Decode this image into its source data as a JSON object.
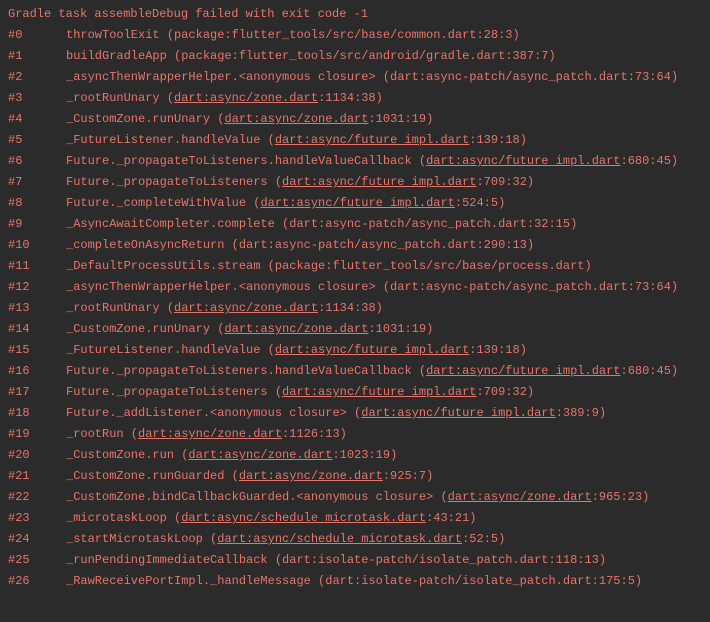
{
  "header": "Gradle task assembleDebug failed with exit code -1",
  "frames": [
    {
      "num": "#0",
      "prefix": "throwToolExit (package:flutter_tools/src/base/common.dart:28:3)",
      "link": null,
      "suffix": null
    },
    {
      "num": "#1",
      "prefix": "buildGradleApp (package:flutter_tools/src/android/gradle.dart:387:7)",
      "link": null,
      "suffix": null
    },
    {
      "num": "#2",
      "prefix": "_asyncThenWrapperHelper.<anonymous closure> (dart:async-patch/async_patch.dart:73:64)",
      "link": null,
      "suffix": null
    },
    {
      "num": "#3",
      "prefix": "_rootRunUnary (",
      "link": "dart:async/zone.dart",
      "suffix": ":1134:38)"
    },
    {
      "num": "#4",
      "prefix": "_CustomZone.runUnary (",
      "link": "dart:async/zone.dart",
      "suffix": ":1031:19)"
    },
    {
      "num": "#5",
      "prefix": "_FutureListener.handleValue (",
      "link": "dart:async/future impl.dart",
      "suffix": ":139:18)"
    },
    {
      "num": "#6",
      "prefix": "Future._propagateToListeners.handleValueCallback (",
      "link": "dart:async/future impl.dart",
      "suffix": ":680:45)"
    },
    {
      "num": "#7",
      "prefix": "Future._propagateToListeners (",
      "link": "dart:async/future impl.dart",
      "suffix": ":709:32)"
    },
    {
      "num": "#8",
      "prefix": "Future._completeWithValue (",
      "link": "dart:async/future impl.dart",
      "suffix": ":524:5)"
    },
    {
      "num": "#9",
      "prefix": "_AsyncAwaitCompleter.complete (dart:async-patch/async_patch.dart:32:15)",
      "link": null,
      "suffix": null
    },
    {
      "num": "#10",
      "prefix": "_completeOnAsyncReturn (dart:async-patch/async_patch.dart:290:13)",
      "link": null,
      "suffix": null
    },
    {
      "num": "#11",
      "prefix": "_DefaultProcessUtils.stream (package:flutter_tools/src/base/process.dart)",
      "link": null,
      "suffix": null
    },
    {
      "num": "#12",
      "prefix": "_asyncThenWrapperHelper.<anonymous closure> (dart:async-patch/async_patch.dart:73:64)",
      "link": null,
      "suffix": null
    },
    {
      "num": "#13",
      "prefix": "_rootRunUnary (",
      "link": "dart:async/zone.dart",
      "suffix": ":1134:38)"
    },
    {
      "num": "#14",
      "prefix": "_CustomZone.runUnary (",
      "link": "dart:async/zone.dart",
      "suffix": ":1031:19)"
    },
    {
      "num": "#15",
      "prefix": "_FutureListener.handleValue (",
      "link": "dart:async/future impl.dart",
      "suffix": ":139:18)"
    },
    {
      "num": "#16",
      "prefix": "Future._propagateToListeners.handleValueCallback (",
      "link": "dart:async/future impl.dart",
      "suffix": ":680:45)"
    },
    {
      "num": "#17",
      "prefix": "Future._propagateToListeners (",
      "link": "dart:async/future impl.dart",
      "suffix": ":709:32)"
    },
    {
      "num": "#18",
      "prefix": "Future._addListener.<anonymous closure> (",
      "link": "dart:async/future impl.dart",
      "suffix": ":389:9)"
    },
    {
      "num": "#19",
      "prefix": "_rootRun (",
      "link": "dart:async/zone.dart",
      "suffix": ":1126:13)"
    },
    {
      "num": "#20",
      "prefix": "_CustomZone.run (",
      "link": "dart:async/zone.dart",
      "suffix": ":1023:19)"
    },
    {
      "num": "#21",
      "prefix": "_CustomZone.runGuarded (",
      "link": "dart:async/zone.dart",
      "suffix": ":925:7)"
    },
    {
      "num": "#22",
      "prefix": "_CustomZone.bindCallbackGuarded.<anonymous closure> (",
      "link": "dart:async/zone.dart",
      "suffix": ":965:23)"
    },
    {
      "num": "#23",
      "prefix": "_microtaskLoop (",
      "link": "dart:async/schedule microtask.dart",
      "suffix": ":43:21)"
    },
    {
      "num": "#24",
      "prefix": "_startMicrotaskLoop (",
      "link": "dart:async/schedule microtask.dart",
      "suffix": ":52:5)"
    },
    {
      "num": "#25",
      "prefix": "_runPendingImmediateCallback (dart:isolate-patch/isolate_patch.dart:118:13)",
      "link": null,
      "suffix": null
    },
    {
      "num": "#26",
      "prefix": "_RawReceivePortImpl._handleMessage (dart:isolate-patch/isolate_patch.dart:175:5)",
      "link": null,
      "suffix": null
    }
  ]
}
